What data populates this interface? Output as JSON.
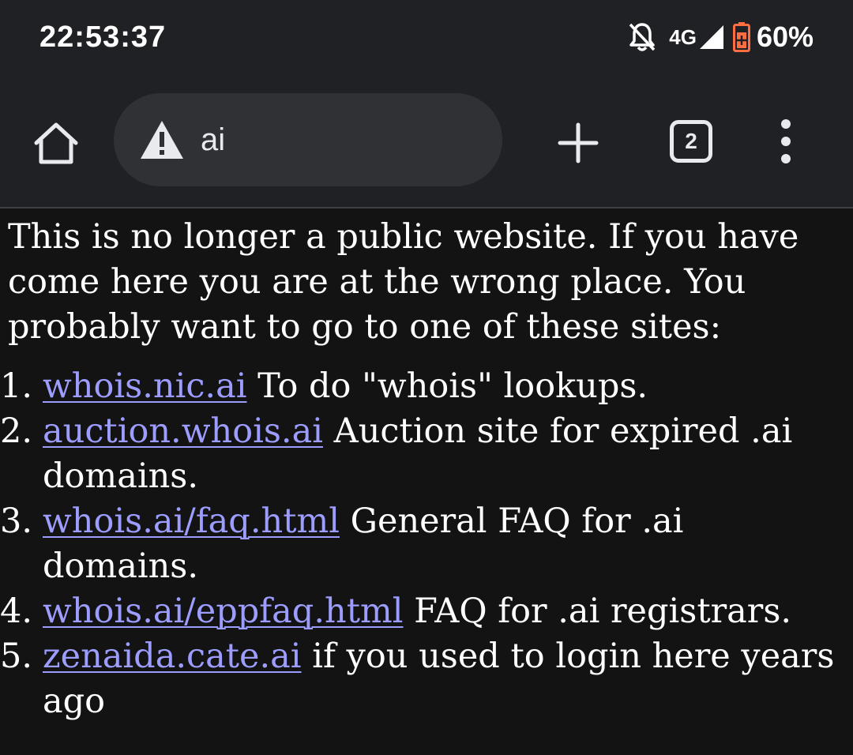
{
  "status_bar": {
    "time": "22:53:37",
    "network": "4G",
    "battery_percent": "60%",
    "icons": [
      "bell-off-icon",
      "signal-icon",
      "battery-icon"
    ],
    "battery_color": "#ff6e40"
  },
  "toolbar": {
    "home_icon": "home-icon",
    "security_icon": "warning-icon",
    "url": "ai",
    "new_tab_icon": "plus-icon",
    "tab_count": "2",
    "menu_icon": "more-vert-icon"
  },
  "page": {
    "intro": "This is no longer a public website. If you have come here you are at the wrong place. You probably want to go to one of these sites:",
    "items": [
      {
        "num": "1.",
        "link": "whois.nic.ai",
        "text": " To do \"whois\" lookups."
      },
      {
        "num": "2.",
        "link": "auction.whois.ai",
        "text": " Auction site for expired .ai domains."
      },
      {
        "num": "3.",
        "link": "whois.ai/faq.html",
        "text": " General FAQ for .ai domains."
      },
      {
        "num": "4.",
        "link": "whois.ai/eppfaq.html",
        "text": " FAQ for .ai registrars."
      },
      {
        "num": "5.",
        "link": "zenaida.cate.ai",
        "text": " if you used to login here years ago"
      }
    ]
  },
  "colors": {
    "background": "#131313",
    "chrome": "#202124",
    "omnibox": "#303134",
    "link": "#9d9dff"
  }
}
